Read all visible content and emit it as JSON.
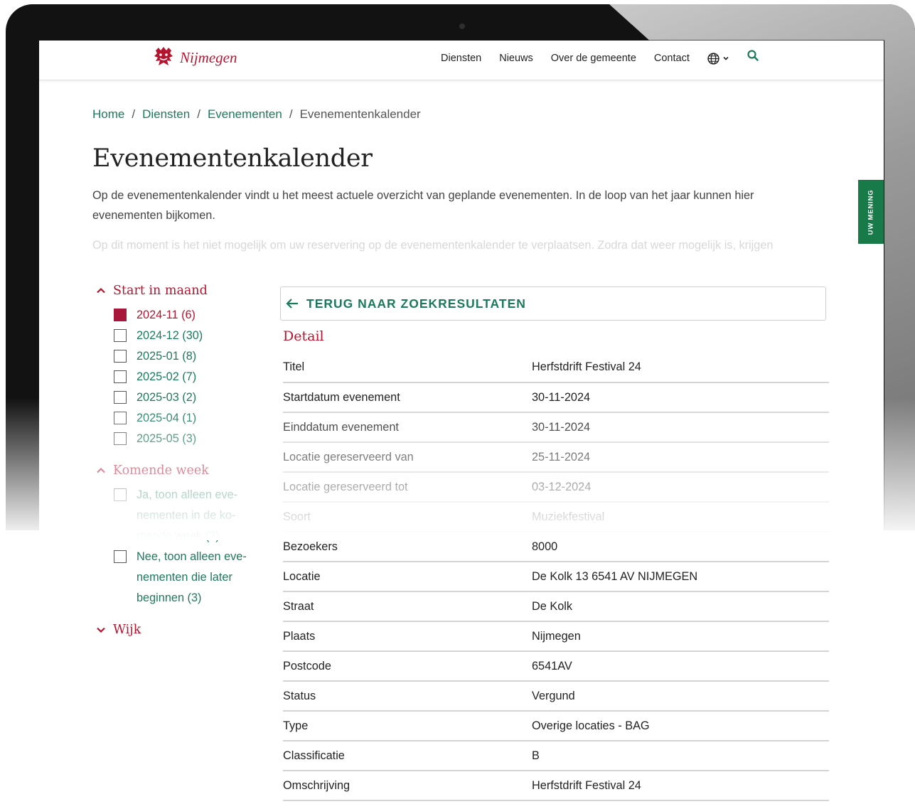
{
  "header": {
    "logo_text": "Nijmegen",
    "nav": [
      "Diensten",
      "Nieuws",
      "Over de gemeente",
      "Contact"
    ],
    "icons": [
      "globe-icon",
      "chevron-down-icon",
      "search-icon"
    ]
  },
  "breadcrumb": {
    "items": [
      "Home",
      "Diensten",
      "Evenementen"
    ],
    "current": "Evenementenkalender",
    "separator": "/"
  },
  "page": {
    "title": "Evenementenkalender",
    "intro": "Op de evenementenkalender vindt u het meest actuele overzicht van geplande evenementen. In de loop van het jaar kunnen hier evenementen bijkomen.",
    "intro2": "Op dit moment is het niet mogelijk om uw reservering op de evenementenkalender te verplaatsen. Zodra dat weer mogelijk is, krijgen"
  },
  "feedback_tab": "UW MENING",
  "filters": {
    "start_maand": {
      "title": "Start in maand",
      "options": [
        {
          "label": "2024-11 (6)",
          "checked": true
        },
        {
          "label": "2024-12 (30)",
          "checked": false
        },
        {
          "label": "2025-01 (8)",
          "checked": false
        },
        {
          "label": "2025-02 (7)",
          "checked": false
        },
        {
          "label": "2025-03 (2)",
          "checked": false
        },
        {
          "label": "2025-04 (1)",
          "checked": false
        },
        {
          "label": "2025-05 (3)",
          "checked": false
        }
      ]
    },
    "komende_week": {
      "title": "Komende week",
      "options": [
        {
          "line1": "Ja, toon alleen eve-",
          "line2": "nementen in de ko-",
          "line3": "mende week (3)"
        },
        {
          "line1": "Nee, toon alleen eve-",
          "line2": "nementen die later",
          "line3": "beginnen (3)"
        }
      ]
    },
    "wijk": {
      "title": "Wijk"
    }
  },
  "detail": {
    "back_label": "TERUG NAAR ZOEKRESULTATEN",
    "title": "Detail",
    "rows": [
      {
        "label": "Titel",
        "value": "Herfstdrift Festival 24"
      },
      {
        "label": "Startdatum evenement",
        "value": "30-11-2024"
      },
      {
        "label": "Einddatum evenement",
        "value": "30-11-2024"
      },
      {
        "label": "Locatie gereserveerd van",
        "value": "25-11-2024"
      },
      {
        "label": "Locatie gereserveerd tot",
        "value": "03-12-2024"
      },
      {
        "label": "Soort",
        "value": "Muziekfestival"
      },
      {
        "label": "Bezoekers",
        "value": "8000"
      },
      {
        "label": "Locatie",
        "value": "De Kolk 13 6541 AV NIJMEGEN"
      },
      {
        "label": "Straat",
        "value": "De Kolk"
      },
      {
        "label": "Plaats",
        "value": "Nijmegen"
      },
      {
        "label": "Postcode",
        "value": "6541AV"
      },
      {
        "label": "Status",
        "value": "Vergund"
      },
      {
        "label": "Type",
        "value": "Overige locaties - BAG"
      },
      {
        "label": "Classificatie",
        "value": "B"
      },
      {
        "label": "Omschrijving",
        "value": "Herfstdrift Festival 24"
      }
    ]
  },
  "colors": {
    "brand_red": "#b5142f",
    "link_green": "#1c7a5c",
    "feedback_green": "#177a48"
  }
}
